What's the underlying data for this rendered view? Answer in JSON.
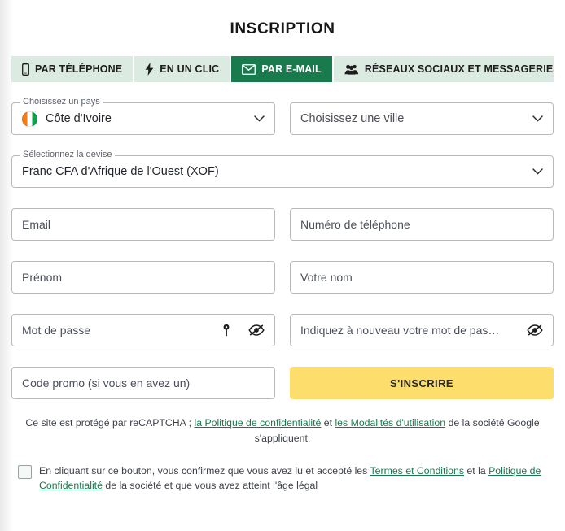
{
  "page": {
    "title": "INSCRIPTION"
  },
  "tabs": [
    {
      "label": "PAR TÉLÉPHONE",
      "icon": "phone-icon",
      "active": false
    },
    {
      "label": "EN UN CLIC",
      "icon": "lightning-bolt-icon",
      "active": false
    },
    {
      "label": "PAR E-MAIL",
      "icon": "envelope-icon",
      "active": true
    },
    {
      "label": "RÉSEAUX SOCIAUX ET MESSAGERIES",
      "icon": "users-group-icon",
      "active": false
    }
  ],
  "form": {
    "country": {
      "legend": "Choisissez un pays",
      "value": "Côte d'Ivoire",
      "flag": "cote-divoire-flag-icon"
    },
    "city": {
      "placeholder": "Choisissez une ville"
    },
    "currency": {
      "legend": "Sélectionnez la devise",
      "value": "Franc CFA d'Afrique de l'Ouest (XOF)"
    },
    "email": {
      "placeholder": "Email",
      "value": ""
    },
    "phone": {
      "placeholder": "Numéro de téléphone",
      "value": ""
    },
    "firstname": {
      "placeholder": "Prénom",
      "value": ""
    },
    "lastname": {
      "placeholder": "Votre nom",
      "value": ""
    },
    "password": {
      "placeholder": "Mot de passe",
      "value": ""
    },
    "password_repeat": {
      "placeholder": "Indiquez à nouveau votre mot de pas…",
      "value": ""
    },
    "promo": {
      "placeholder": "Code promo (si vous en avez un)",
      "value": ""
    },
    "submit_label": "S'INSCRIRE"
  },
  "recaptcha": {
    "part1": "Ce site est protégé par reCAPTCHA ; ",
    "link1": "la Politique de confidentialité",
    "part2": " et ",
    "link2": "les Modalités d'utilisation",
    "part3": " de la société Google s'appliquent."
  },
  "terms": {
    "checked": false,
    "part1": "En cliquant sur ce bouton, vous confirmez que vous avez lu et accepté les ",
    "link1": "Termes et Conditions",
    "part2": " et la ",
    "link2": "Politique de Confidentialité",
    "part3": " de la société et que vous avez atteint l'âge légal"
  },
  "colors": {
    "brand_green": "#187a4d",
    "tab_inactive": "#dcebe2",
    "submit_yellow": "#fdde6c",
    "link_green": "#17794c"
  }
}
